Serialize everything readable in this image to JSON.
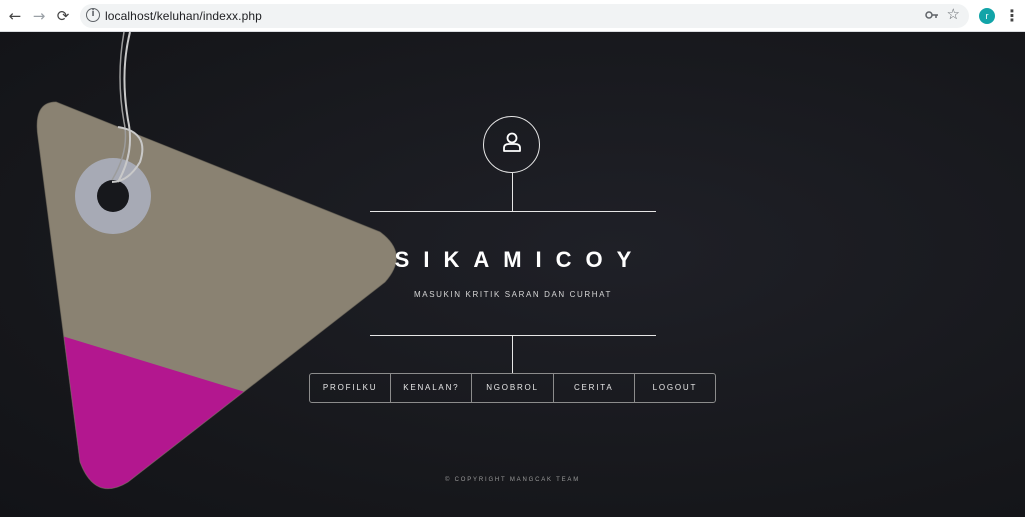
{
  "browser": {
    "url": "localhost/keluhan/indexx.php",
    "profile_initial": "r",
    "menu_glyph": "⋮"
  },
  "icons": {
    "back": "back-arrow-icon",
    "forward": "forward-arrow-icon",
    "reload": "reload-icon",
    "site_info": "info-icon",
    "password_key": "key-icon",
    "bookmark": "star-icon",
    "user": "user-icon"
  },
  "colors": {
    "tag_body": "#8a8272",
    "tag_accent": "#b3178f",
    "background": "#1a1b20"
  },
  "header": {
    "title": "SIKAMICOY",
    "subtitle": "MASUKIN KRITIK SARAN DAN CURHAT"
  },
  "nav": {
    "items": [
      "PROFILKU",
      "KENALAN?",
      "NGOBROL",
      "CERITA",
      "LOGOUT"
    ]
  },
  "footer": {
    "copyright": "© COPYRIGHT MANGCAK TEAM"
  }
}
